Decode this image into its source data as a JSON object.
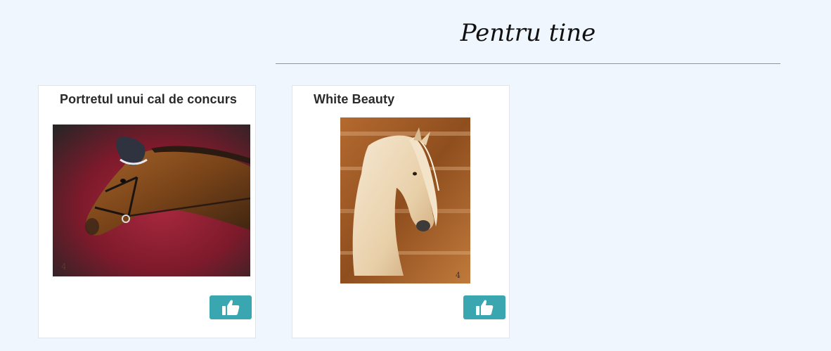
{
  "section": {
    "title": "Pentru tine"
  },
  "cards": [
    {
      "title": "Portretul unui cal de concurs",
      "image_icon": "horse-portrait-painting-icon",
      "like_icon": "thumbs-up-icon"
    },
    {
      "title": "White Beauty",
      "image_icon": "white-horse-painting-icon",
      "like_icon": "thumbs-up-icon"
    }
  ],
  "colors": {
    "page_background": "#eff6fe",
    "card_background": "#ffffff",
    "like_button": "#3aa6b0",
    "title_text": "#2a2a2a",
    "divider": "#8e9499"
  }
}
